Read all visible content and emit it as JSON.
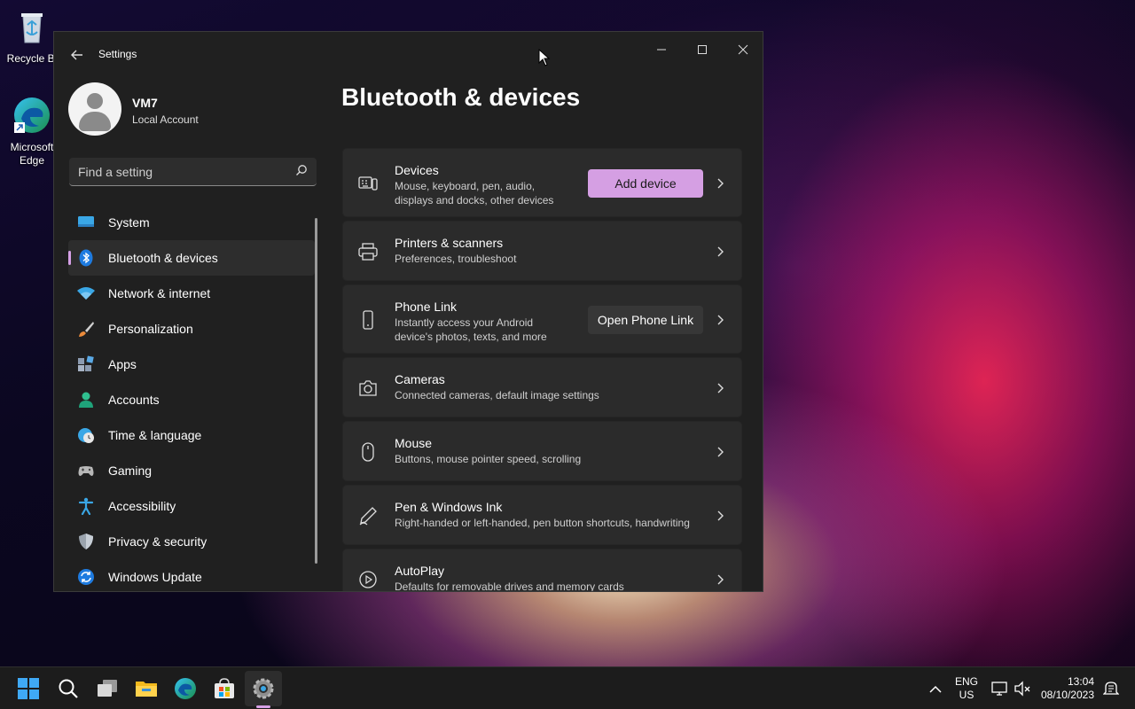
{
  "desktop": {
    "icons": [
      {
        "label": "Recycle Bi"
      },
      {
        "label": "Microsoft Edge"
      }
    ]
  },
  "window": {
    "title": "Settings",
    "controls": {
      "minimize": "—",
      "maximize": "☐",
      "close": "✕"
    }
  },
  "profile": {
    "name": "VM7",
    "account_type": "Local Account"
  },
  "search": {
    "placeholder": "Find a setting"
  },
  "sidebar": {
    "items": [
      {
        "label": "System",
        "icon": "monitor-icon",
        "active": false
      },
      {
        "label": "Bluetooth & devices",
        "icon": "bluetooth-icon",
        "active": true
      },
      {
        "label": "Network & internet",
        "icon": "wifi-icon",
        "active": false
      },
      {
        "label": "Personalization",
        "icon": "brush-icon",
        "active": false
      },
      {
        "label": "Apps",
        "icon": "apps-icon",
        "active": false
      },
      {
        "label": "Accounts",
        "icon": "person-icon",
        "active": false
      },
      {
        "label": "Time & language",
        "icon": "globe-clock-icon",
        "active": false
      },
      {
        "label": "Gaming",
        "icon": "gamepad-icon",
        "active": false
      },
      {
        "label": "Accessibility",
        "icon": "accessibility-icon",
        "active": false
      },
      {
        "label": "Privacy & security",
        "icon": "shield-icon",
        "active": false
      },
      {
        "label": "Windows Update",
        "icon": "update-icon",
        "active": false
      }
    ]
  },
  "main": {
    "title": "Bluetooth & devices",
    "cards": [
      {
        "title": "Devices",
        "desc": [
          "Mouse, keyboard, pen, audio,",
          "displays and docks, other devices"
        ],
        "button": "Add device",
        "icon": "devices-icon"
      },
      {
        "title": "Printers & scanners",
        "desc": [
          "Preferences, troubleshoot"
        ],
        "icon": "printer-icon"
      },
      {
        "title": "Phone Link",
        "desc": [
          "Instantly access your Android",
          "device's photos, texts, and more"
        ],
        "button": "Open Phone Link",
        "icon": "phone-icon"
      },
      {
        "title": "Cameras",
        "desc": [
          "Connected cameras, default image settings"
        ],
        "icon": "camera-icon"
      },
      {
        "title": "Mouse",
        "desc": [
          "Buttons, mouse pointer speed, scrolling"
        ],
        "icon": "mouse-icon"
      },
      {
        "title": "Pen & Windows Ink",
        "desc": [
          "Right-handed or left-handed, pen button shortcuts, handwriting"
        ],
        "icon": "pen-icon"
      },
      {
        "title": "AutoPlay",
        "desc": [
          "Defaults for removable drives and memory cards"
        ],
        "icon": "autoplay-icon"
      }
    ]
  },
  "taskbar": {
    "apps": [
      "start-icon",
      "search-icon",
      "task-view-icon",
      "file-explorer-icon",
      "edge-icon",
      "store-icon",
      "settings-icon"
    ],
    "language": {
      "line1": "ENG",
      "line2": "US"
    },
    "clock": {
      "time": "13:04",
      "date": "08/10/2023"
    }
  },
  "colors": {
    "accent": "#d59fe3",
    "window_bg": "#202020",
    "card_bg": "#2b2b2b",
    "taskbar_bg": "#1c1c1c"
  }
}
